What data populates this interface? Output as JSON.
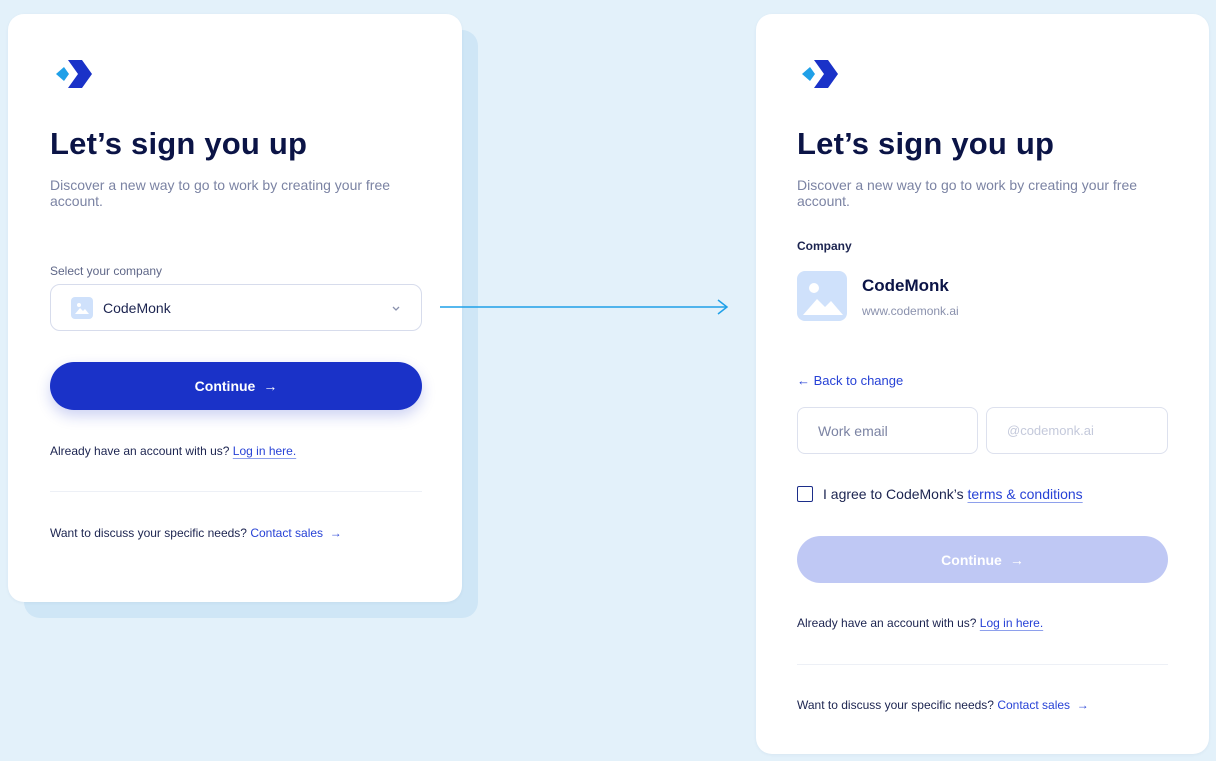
{
  "colors": {
    "background": "#e3f1fa",
    "primary": "#1a32c8",
    "primary_disabled": "#bfc8f4",
    "link": "#2742d6",
    "heading": "#0b1446"
  },
  "logo_icon": "arrow-chevron-logo",
  "left": {
    "title": "Let’s sign you up",
    "subtitle": "Discover a new way to go to work by creating your free account.",
    "select_label": "Select your company",
    "select_value": "CodeMonk",
    "continue_label": "Continue",
    "login_prompt": "Already have an account with us?",
    "login_link": "Log in here.",
    "sales_prompt": "Want to discuss your specific needs?",
    "sales_link": "Contact sales"
  },
  "right": {
    "title": "Let’s sign you up",
    "subtitle": "Discover a new way to go to work by creating your free account.",
    "company_label": "Company",
    "company_name": "CodeMonk",
    "company_url": "www.codemonk.ai",
    "back_link": "← Back to change",
    "email_placeholder": "Work email",
    "domain_placeholder": "@codemonk.ai",
    "agree_text": "I agree to CodeMonk’s",
    "terms_link": "terms & conditions",
    "continue_label": "Continue",
    "login_prompt": "Already have an account with us?",
    "login_link": "Log in here.",
    "sales_prompt": "Want to discuss your specific needs?",
    "sales_link": "Contact sales"
  }
}
